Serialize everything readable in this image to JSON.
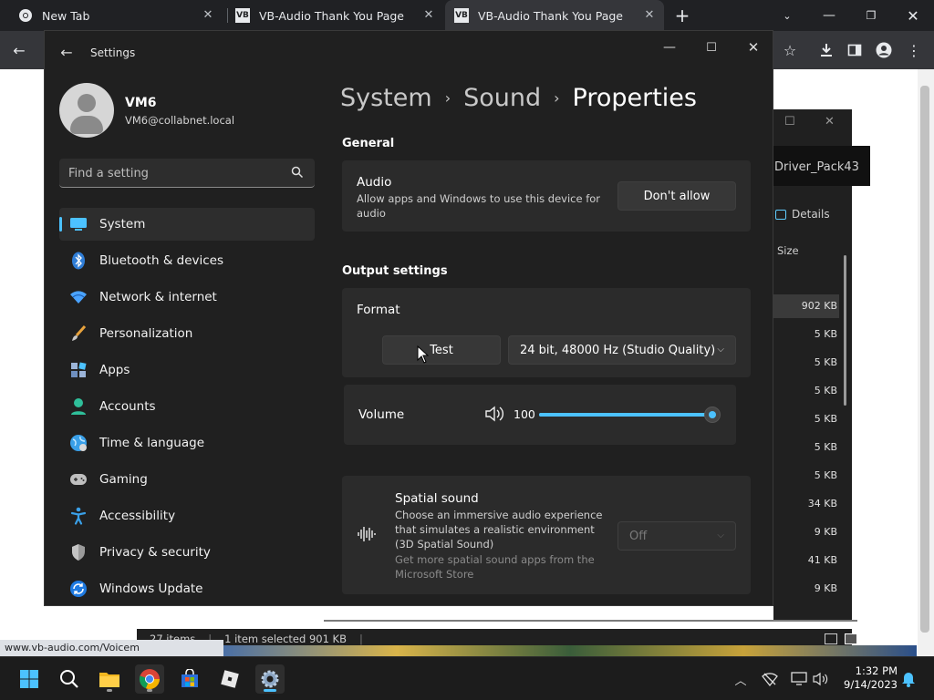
{
  "browser": {
    "tabs": [
      {
        "title": "New Tab"
      },
      {
        "title": "VB-Audio Thank You Page",
        "favicon": "VB"
      },
      {
        "title": "VB-Audio Thank You Page",
        "favicon": "VB",
        "active": true
      }
    ],
    "status_url": "www.vb-audio.com/Voicem"
  },
  "explorer": {
    "title_partial": "Driver_Pack43",
    "details_label": "Details",
    "size_header": "Size",
    "sizes": [
      "902 KB",
      "5 KB",
      "5 KB",
      "5 KB",
      "5 KB",
      "5 KB",
      "5 KB",
      "34 KB",
      "9 KB",
      "41 KB",
      "9 KB"
    ],
    "status": {
      "items": "27 items",
      "selected": "1 item selected  901 KB"
    }
  },
  "settings": {
    "title": "Settings",
    "user": {
      "name": "VM6",
      "email": "VM6@collabnet.local"
    },
    "search_placeholder": "Find a setting",
    "nav": [
      {
        "label": "System",
        "icon": "system-icon",
        "active": true
      },
      {
        "label": "Bluetooth & devices",
        "icon": "bluetooth-icon"
      },
      {
        "label": "Network & internet",
        "icon": "network-icon"
      },
      {
        "label": "Personalization",
        "icon": "brush-icon"
      },
      {
        "label": "Apps",
        "icon": "apps-icon"
      },
      {
        "label": "Accounts",
        "icon": "accounts-icon"
      },
      {
        "label": "Time & language",
        "icon": "globe-icon"
      },
      {
        "label": "Gaming",
        "icon": "gamepad-icon"
      },
      {
        "label": "Accessibility",
        "icon": "accessibility-icon"
      },
      {
        "label": "Privacy & security",
        "icon": "shield-icon"
      },
      {
        "label": "Windows Update",
        "icon": "update-icon"
      }
    ],
    "breadcrumb": [
      "System",
      "Sound",
      "Properties"
    ],
    "general": {
      "heading": "General",
      "audio_title": "Audio",
      "audio_desc": "Allow apps and Windows to use this device for audio",
      "dont_allow": "Don't allow"
    },
    "output": {
      "heading": "Output settings",
      "format_title": "Format",
      "test_label": "Test",
      "format_value": "24 bit, 48000 Hz (Studio Quality)",
      "volume_title": "Volume",
      "volume_value": "100",
      "volume_level": 1.0
    },
    "spatial": {
      "title": "Spatial sound",
      "desc": "Choose an immersive audio experience that simulates a realistic environment (3D Spatial Sound)",
      "store_link": "Get more spatial sound apps from the Microsoft Store",
      "value": "Off"
    }
  },
  "taskbar": {
    "time": "1:32 PM",
    "date": "9/14/2023"
  },
  "colors": {
    "accent": "#4cc2ff",
    "window_bg": "#202020",
    "card_bg": "#2b2b2b"
  }
}
